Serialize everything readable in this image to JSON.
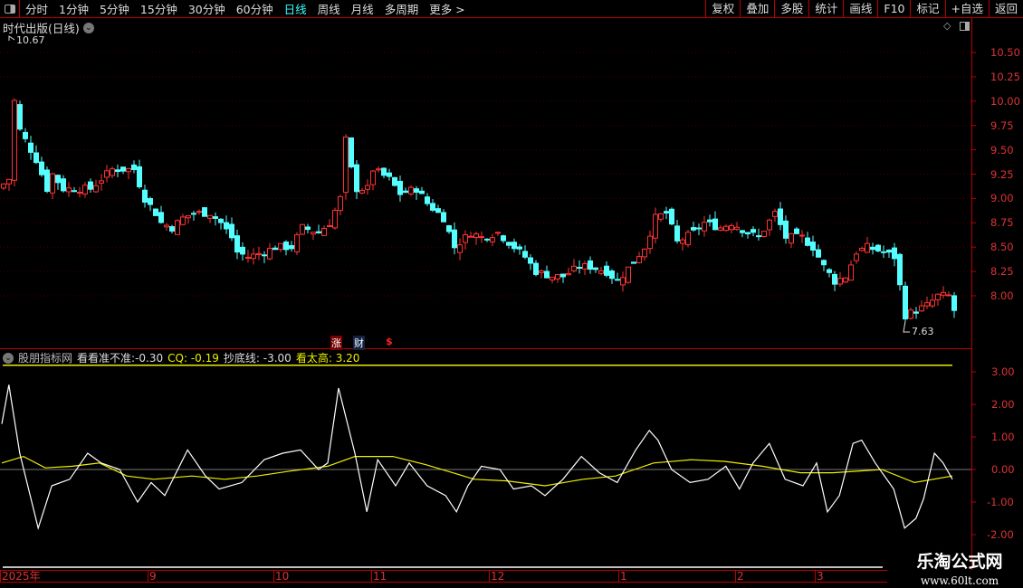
{
  "toolbar": {
    "periods": [
      "分时",
      "1分钟",
      "5分钟",
      "15分钟",
      "30分钟",
      "60分钟",
      "日线",
      "周线",
      "月线",
      "多周期",
      "更多 >"
    ],
    "active": "日线",
    "buttons": [
      "复权",
      "叠加",
      "多股",
      "统计",
      "画线",
      "F10",
      "标记",
      "+自选",
      "返回"
    ]
  },
  "chart": {
    "title": "时代出版(日线)",
    "max_label": "10.67",
    "min_label": "7.63",
    "price_axis": [
      "10.50",
      "10.25",
      "10.00",
      "9.75",
      "9.50",
      "9.25",
      "9.00",
      "8.75",
      "8.50",
      "8.25",
      "8.00"
    ],
    "badges": [
      "涨",
      "财",
      "$"
    ],
    "closes": [
      [
        1,
        9.2
      ],
      [
        2,
        10.0
      ],
      [
        3,
        9.7
      ],
      [
        4,
        9.6
      ],
      [
        6,
        9.4
      ],
      [
        8,
        9.1
      ],
      [
        9,
        9.25
      ],
      [
        11,
        9.1
      ],
      [
        13,
        9.1
      ],
      [
        16,
        9.1
      ],
      [
        18,
        9.2
      ],
      [
        20,
        9.3
      ],
      [
        22,
        9.3
      ],
      [
        24,
        9.3
      ],
      [
        26,
        9.0
      ],
      [
        28,
        8.85
      ],
      [
        29,
        8.75
      ],
      [
        31,
        8.7
      ],
      [
        33,
        8.8
      ],
      [
        35,
        8.85
      ],
      [
        38,
        8.85
      ],
      [
        40,
        8.75
      ],
      [
        42,
        8.6
      ],
      [
        43,
        8.45
      ],
      [
        45,
        8.4
      ],
      [
        48,
        8.45
      ],
      [
        50,
        8.5
      ],
      [
        53,
        8.5
      ],
      [
        55,
        8.7
      ],
      [
        58,
        8.65
      ],
      [
        60,
        8.75
      ],
      [
        62,
        9.0
      ],
      [
        63,
        9.6
      ],
      [
        64,
        9.3
      ],
      [
        65,
        9.1
      ],
      [
        67,
        9.1
      ],
      [
        68,
        9.3
      ],
      [
        71,
        9.2
      ],
      [
        73,
        9.05
      ],
      [
        76,
        9.1
      ],
      [
        78,
        8.95
      ],
      [
        81,
        8.8
      ],
      [
        83,
        8.5
      ],
      [
        86,
        8.65
      ],
      [
        88,
        8.6
      ],
      [
        91,
        8.65
      ],
      [
        93,
        8.55
      ],
      [
        96,
        8.4
      ],
      [
        98,
        8.25
      ],
      [
        101,
        8.2
      ],
      [
        103,
        8.2
      ],
      [
        106,
        8.3
      ],
      [
        108,
        8.3
      ],
      [
        111,
        8.25
      ],
      [
        113,
        8.15
      ],
      [
        116,
        8.35
      ],
      [
        118,
        8.5
      ],
      [
        120,
        8.8
      ],
      [
        122,
        8.85
      ],
      [
        124,
        8.55
      ],
      [
        127,
        8.65
      ],
      [
        129,
        8.75
      ],
      [
        132,
        8.7
      ],
      [
        134,
        8.75
      ],
      [
        137,
        8.65
      ],
      [
        139,
        8.6
      ],
      [
        142,
        8.85
      ],
      [
        144,
        8.6
      ],
      [
        147,
        8.6
      ],
      [
        149,
        8.5
      ],
      [
        151,
        8.3
      ],
      [
        153,
        8.15
      ],
      [
        155,
        8.2
      ],
      [
        157,
        8.45
      ],
      [
        159,
        8.5
      ],
      [
        162,
        8.45
      ],
      [
        164,
        8.4
      ],
      [
        166,
        7.8
      ],
      [
        168,
        7.85
      ],
      [
        170,
        7.9
      ],
      [
        172,
        8.0
      ],
      [
        174,
        8.0
      ],
      [
        175,
        7.85
      ]
    ]
  },
  "indicator": {
    "name": "股朋指标网",
    "items": [
      {
        "label": "看看准不准:",
        "value": "-0.30"
      },
      {
        "label": "CQ:",
        "value": "-0.19"
      },
      {
        "label": "抄底线:",
        "value": "-3.00"
      },
      {
        "label": "看太高:",
        "value": "3.20"
      }
    ],
    "axis": [
      "3.00",
      "2.00",
      "1.00",
      "0.00",
      "-1.00",
      "-2.00"
    ],
    "white": [
      [
        0,
        1.4
      ],
      [
        1.3,
        2.6
      ],
      [
        3.3,
        0.5
      ],
      [
        6.7,
        -1.8
      ],
      [
        9.2,
        -0.5
      ],
      [
        12.5,
        -0.3
      ],
      [
        15.8,
        0.5
      ],
      [
        18.3,
        0.2
      ],
      [
        21.7,
        0
      ],
      [
        25,
        -1.0
      ],
      [
        27.5,
        -0.4
      ],
      [
        30,
        -0.8
      ],
      [
        34.2,
        0.6
      ],
      [
        37.5,
        -0.2
      ],
      [
        40,
        -0.6
      ],
      [
        44.2,
        -0.4
      ],
      [
        48.3,
        0.3
      ],
      [
        51.7,
        0.5
      ],
      [
        55,
        0.6
      ],
      [
        58.3,
        0
      ],
      [
        60,
        0.2
      ],
      [
        62,
        2.5
      ],
      [
        65,
        0.5
      ],
      [
        67.2,
        -1.3
      ],
      [
        69.2,
        0.3
      ],
      [
        72.5,
        -0.5
      ],
      [
        75,
        0.2
      ],
      [
        78.3,
        -0.5
      ],
      [
        81.7,
        -0.8
      ],
      [
        83.7,
        -1.3
      ],
      [
        85.8,
        -0.5
      ],
      [
        88.3,
        0.1
      ],
      [
        91.7,
        0
      ],
      [
        94.2,
        -0.6
      ],
      [
        97.5,
        -0.5
      ],
      [
        100,
        -0.8
      ],
      [
        103.3,
        -0.3
      ],
      [
        106.7,
        0.4
      ],
      [
        110,
        -0.1
      ],
      [
        113.3,
        -0.4
      ],
      [
        116.7,
        0.6
      ],
      [
        119.2,
        1.2
      ],
      [
        120.8,
        0.9
      ],
      [
        123.3,
        0
      ],
      [
        126.7,
        -0.4
      ],
      [
        130,
        -0.3
      ],
      [
        133.3,
        0.1
      ],
      [
        135.8,
        -0.6
      ],
      [
        138.3,
        0.2
      ],
      [
        141.3,
        0.8
      ],
      [
        144.2,
        -0.3
      ],
      [
        147.5,
        -0.5
      ],
      [
        150,
        0.2
      ],
      [
        152,
        -1.3
      ],
      [
        154.2,
        -0.8
      ],
      [
        156.7,
        0.8
      ],
      [
        158.3,
        0.9
      ],
      [
        160.8,
        0.2
      ],
      [
        164.2,
        -0.6
      ],
      [
        166.2,
        -1.8
      ],
      [
        168.3,
        -1.5
      ],
      [
        169.7,
        -0.9
      ],
      [
        171.7,
        0.5
      ],
      [
        173.3,
        0.2
      ],
      [
        175,
        -0.3
      ]
    ],
    "yellow": [
      [
        0,
        0.2
      ],
      [
        4,
        0.4
      ],
      [
        8,
        0.05
      ],
      [
        13,
        0.1
      ],
      [
        18,
        0.2
      ],
      [
        23,
        -0.2
      ],
      [
        28,
        -0.3
      ],
      [
        35,
        -0.2
      ],
      [
        41,
        -0.3
      ],
      [
        47,
        -0.2
      ],
      [
        53,
        -0.05
      ],
      [
        60,
        0.1
      ],
      [
        65,
        0.4
      ],
      [
        72,
        0.4
      ],
      [
        78,
        0.15
      ],
      [
        87,
        -0.3
      ],
      [
        93,
        -0.35
      ],
      [
        100,
        -0.5
      ],
      [
        107,
        -0.3
      ],
      [
        113,
        -0.2
      ],
      [
        120,
        0.2
      ],
      [
        127,
        0.3
      ],
      [
        133,
        0.25
      ],
      [
        140,
        0.1
      ],
      [
        147,
        -0.1
      ],
      [
        153,
        -0.1
      ],
      [
        162,
        0.0
      ],
      [
        168,
        -0.4
      ],
      [
        175,
        -0.2
      ]
    ]
  },
  "dates": [
    "2025年",
    "9",
    "10",
    "11",
    "12",
    "1",
    "2",
    "3"
  ],
  "watermark": {
    "name": "乐淘公式网",
    "url": "www.60lt.com"
  }
}
